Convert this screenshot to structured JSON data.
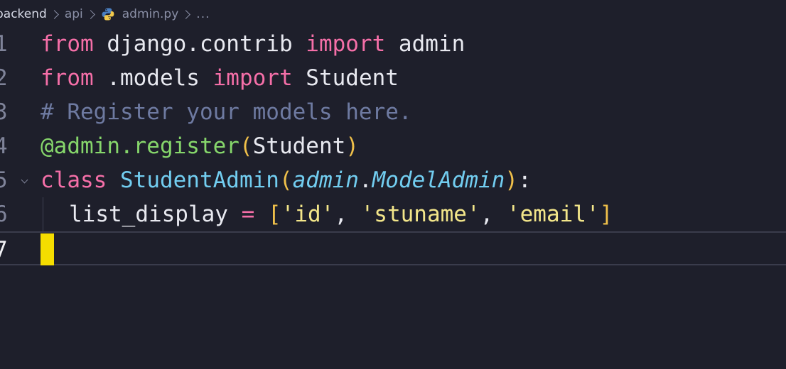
{
  "breadcrumb": {
    "folder": "backend",
    "subfolder": "api",
    "file": "admin.py",
    "ellipsis": "..."
  },
  "editor": {
    "line_numbers": [
      "1",
      "2",
      "3",
      "4",
      "5",
      "6",
      "7"
    ],
    "line1": {
      "kw1": "from",
      "mod": " django.contrib ",
      "kw2": "import",
      "name": " admin"
    },
    "line2": {
      "kw1": "from",
      "mod": " .models ",
      "kw2": "import",
      "name": " Student"
    },
    "line3": {
      "comment": "# Register your models here."
    },
    "line4": {
      "decorator": "@admin.register",
      "open": "(",
      "arg": "Student",
      "close": ")"
    },
    "line5": {
      "kw": "class",
      "classname": " StudentAdmin",
      "open": "(",
      "base1": "admin",
      "dot": ".",
      "base2": "ModelAdmin",
      "close": ")",
      "colon": ":"
    },
    "line6": {
      "attr": "list_display ",
      "eq": "=",
      "space": " ",
      "lbr": "[",
      "s1": "'id'",
      "c1": ", ",
      "s2": "'stuname'",
      "c2": ", ",
      "s3": "'email'",
      "rbr": "]"
    }
  },
  "colors": {
    "background": "#1e1f2b",
    "keyword": "#f56fa8",
    "comment": "#6e7aa1",
    "decorator": "#86d66b",
    "class_name": "#72cdf0",
    "string": "#f3e68a",
    "cursor": "#f5dd00"
  },
  "icons": {
    "python_file": "python-icon"
  }
}
